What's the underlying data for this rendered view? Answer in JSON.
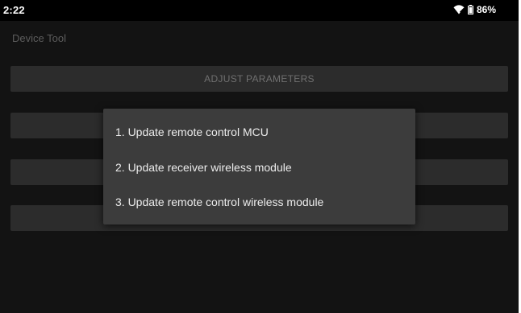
{
  "status_bar": {
    "time": "2:22",
    "battery": "86%",
    "icons": [
      "wifi-icon",
      "battery-icon"
    ]
  },
  "app": {
    "title": "Device Tool",
    "buttons": [
      {
        "label": "ADJUST PARAMETERS"
      },
      {
        "label": ""
      },
      {
        "label": ""
      },
      {
        "label": ""
      }
    ]
  },
  "dialog": {
    "items": [
      {
        "label": "1. Update remote control MCU"
      },
      {
        "label": "2. Update receiver wireless module"
      },
      {
        "label": "3. Update remote control wireless module"
      }
    ]
  },
  "colors": {
    "status_bar": "#000000",
    "app_background": "#131313",
    "button": "#2c2c2c",
    "dialog": "#3c3c3c",
    "dialog_text": "#ececec"
  }
}
